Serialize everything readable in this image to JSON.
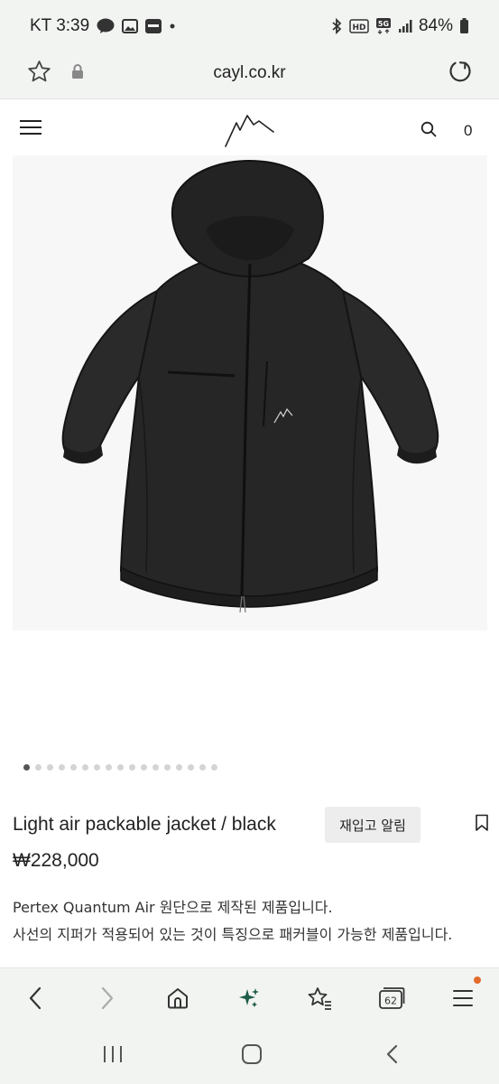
{
  "status_bar": {
    "carrier_time": "KT 3:39",
    "battery": "84%",
    "notification_icons": [
      "talk-icon",
      "gallery-icon",
      "app-icon"
    ],
    "status_icons": [
      "bluetooth-icon",
      "hd-icon",
      "5g-icon",
      "signal-icon",
      "battery-icon"
    ]
  },
  "browser": {
    "url": "cayl.co.kr",
    "icons": [
      "star-icon",
      "lock-icon",
      "reload-icon"
    ]
  },
  "site_header": {
    "cart_count": "0",
    "icons": [
      "hamburger-menu-icon",
      "mountain-logo",
      "search-icon"
    ]
  },
  "product": {
    "image_subject": "black hooded zip jacket",
    "slide_count": 17,
    "active_slide": 1,
    "title": "Light air packable jacket / black",
    "restock_button": "재입고 알림",
    "price": "₩228,000",
    "description": [
      "Pertex Quantum Air 원단으로 제작된 제품입니다.",
      "사선의 지퍼가 적용되어 있는 것이 특징으로 패커블이 가능한 제품입니다."
    ]
  },
  "browser_nav": {
    "tab_count": "62",
    "items": [
      "back-icon",
      "forward-icon",
      "home-icon",
      "sparkle-icon",
      "bookmarks-icon",
      "tabs-icon",
      "menu-icon"
    ],
    "accent_dot_color": "#e36b2b"
  },
  "system_nav": {
    "items": [
      "recent-apps-icon",
      "home-button-icon",
      "back-icon"
    ]
  }
}
